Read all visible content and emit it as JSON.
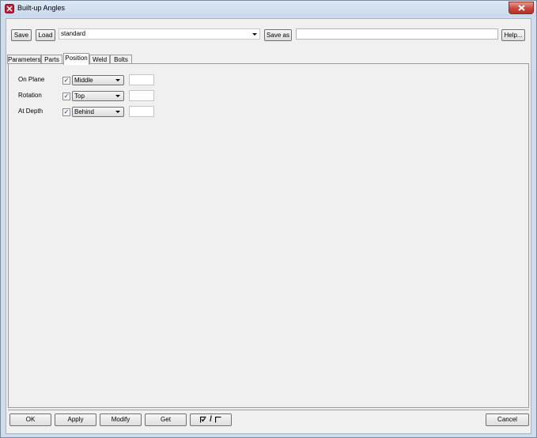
{
  "window": {
    "title": "Built-up Angles",
    "close_icon": "close-icon",
    "app_icon": "tekla-app-icon"
  },
  "toolbar": {
    "save_label": "Save",
    "load_label": "Load",
    "preset_value": "standard",
    "save_as_label": "Save as",
    "save_as_value": "",
    "help_label": "Help..."
  },
  "tabs": [
    {
      "label": "Parameters",
      "active": false
    },
    {
      "label": "Parts",
      "active": false
    },
    {
      "label": "Position",
      "active": true
    },
    {
      "label": "Weld",
      "active": false
    },
    {
      "label": "Bolts",
      "active": false
    }
  ],
  "position": {
    "rows": [
      {
        "label": "On Plane",
        "checked": true,
        "option": "Middle",
        "offset": ""
      },
      {
        "label": "Rotation",
        "checked": true,
        "option": "Top",
        "offset": ""
      },
      {
        "label": "At Depth",
        "checked": true,
        "option": "Behind",
        "offset": ""
      }
    ]
  },
  "footer": {
    "ok_label": "OK",
    "apply_label": "Apply",
    "modify_label": "Modify",
    "get_label": "Get",
    "toggle_label": "/",
    "cancel_label": "Cancel"
  }
}
